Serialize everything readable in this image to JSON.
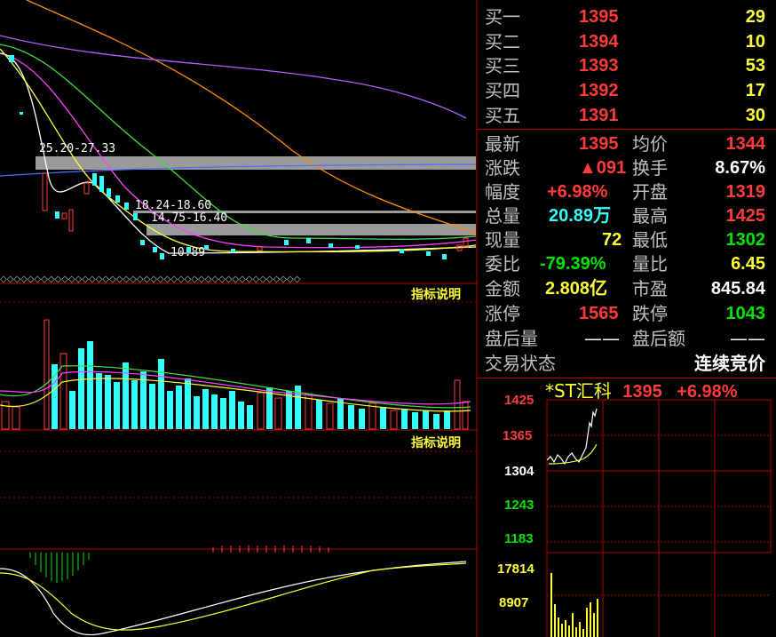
{
  "colors": {
    "up": "#ff3b3b",
    "down": "#00e400",
    "accent": "#ffff33",
    "volume": "#33ffff",
    "grid": "#b00000"
  },
  "kline": {
    "annotations": {
      "zone_high": "25.20-27.33",
      "zone_mid": "18.24-18.60",
      "zone_low": "14.75-16.40",
      "low_price": "10.89"
    },
    "indicator_link": "指标说明"
  },
  "volume_panel": {
    "indicator_link": "指标说明"
  },
  "order_book": {
    "bids": [
      {
        "label": "买一",
        "price": "1395",
        "volume": "29"
      },
      {
        "label": "买二",
        "price": "1394",
        "volume": "10"
      },
      {
        "label": "买三",
        "price": "1393",
        "volume": "53"
      },
      {
        "label": "买四",
        "price": "1392",
        "volume": "17"
      },
      {
        "label": "买五",
        "price": "1391",
        "volume": "30"
      }
    ]
  },
  "quote": {
    "last_label": "最新",
    "last": "1395",
    "avg_label": "均价",
    "avg": "1344",
    "change_label": "涨跌",
    "change": "▲091",
    "turnover_label": "换手",
    "turnover": "8.67%",
    "pct_label": "幅度",
    "pct": "+6.98%",
    "open_label": "开盘",
    "open": "1319",
    "total_vol_label": "总量",
    "total_vol": "20.89万",
    "high_label": "最高",
    "high": "1425",
    "cur_vol_label": "现量",
    "cur_vol": "72",
    "low_label": "最低",
    "low": "1302",
    "bidask_label": "委比",
    "bidask": "-79.39%",
    "vol_ratio_label": "量比",
    "vol_ratio": "6.45",
    "amount_label": "金额",
    "amount": "2.808亿",
    "pe_label": "市盈",
    "pe": "845.84",
    "limit_up_label": "涨停",
    "limit_up": "1565",
    "limit_down_label": "跌停",
    "limit_down": "1043",
    "after_vol_label": "盘后量",
    "after_vol": "——",
    "after_amt_label": "盘后额",
    "after_amt": "——",
    "status_label": "交易状态",
    "status": "连续竞价"
  },
  "mini_chart": {
    "name": "*ST汇科",
    "price": "1395",
    "pct": "+6.98%",
    "y_labels": [
      "1425",
      "1365",
      "1304",
      "1243",
      "1183"
    ],
    "vol_labels": [
      "17814",
      "8907"
    ]
  }
}
